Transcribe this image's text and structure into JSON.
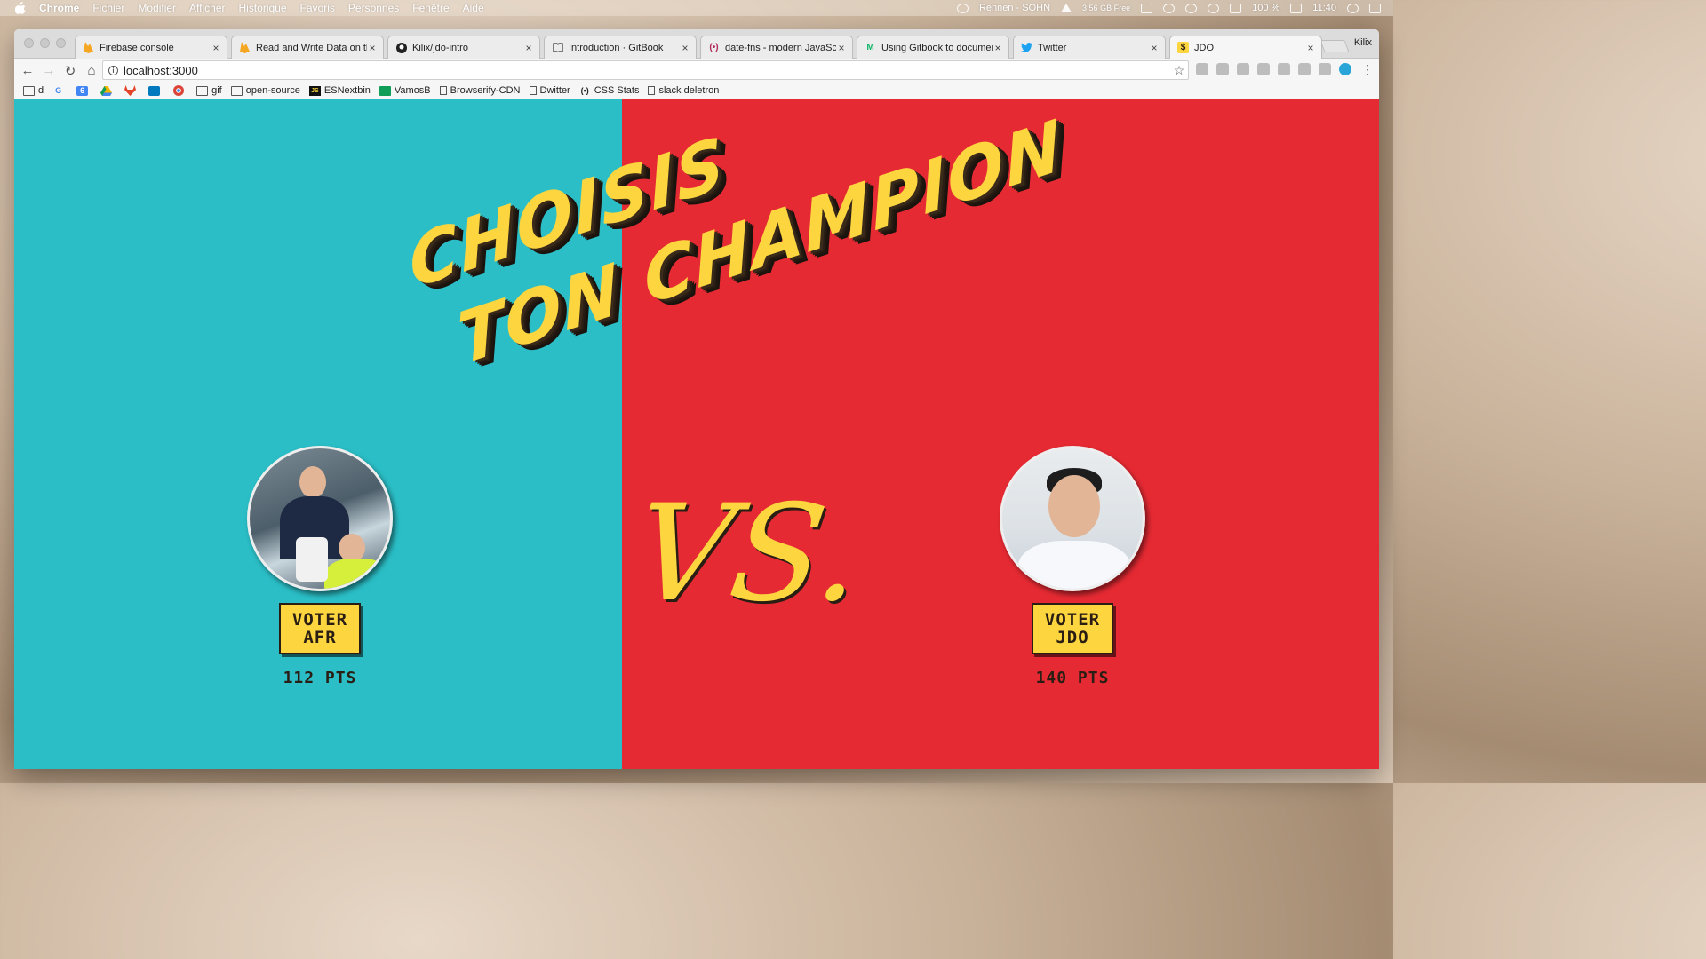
{
  "menubar": {
    "app_name": "Chrome",
    "menus": [
      "Fichier",
      "Modifier",
      "Afficher",
      "Historique",
      "Favoris",
      "Personnes",
      "Fenêtre",
      "Aide"
    ],
    "status_user": "Rennen - SOHN",
    "disk_free": "3,56 GB Free",
    "battery": "100 %",
    "clock": "11:40"
  },
  "browser": {
    "profile_name": "Kilix",
    "tabs": [
      {
        "title": "Firebase console",
        "icon": "firebase-icon",
        "active": false
      },
      {
        "title": "Read and Write Data on the",
        "icon": "firebase-icon",
        "active": false
      },
      {
        "title": "Kilix/jdo-intro",
        "icon": "github-icon",
        "active": false
      },
      {
        "title": "Introduction · GitBook",
        "icon": "gitbook-icon",
        "active": false
      },
      {
        "title": "date-fns - modern JavaScri",
        "icon": "datefns-icon",
        "active": false
      },
      {
        "title": "Using Gitbook to document",
        "icon": "medium-icon",
        "active": false
      },
      {
        "title": "Twitter",
        "icon": "twitter-icon",
        "active": false
      },
      {
        "title": "JDO",
        "icon": "jdo-icon",
        "active": true
      }
    ],
    "url": "localhost:3000",
    "bookmarks": [
      {
        "label": "d",
        "icon": "folder-icon"
      },
      {
        "label": "",
        "icon": "google-icon"
      },
      {
        "label": "",
        "icon": "calendar-icon"
      },
      {
        "label": "",
        "icon": "drive-icon"
      },
      {
        "label": "",
        "icon": "gitlab-icon"
      },
      {
        "label": "",
        "icon": "trello-icon"
      },
      {
        "label": "",
        "icon": "chrome-icon"
      },
      {
        "label": "gif",
        "icon": "folder-icon"
      },
      {
        "label": "open-source",
        "icon": "folder-icon"
      },
      {
        "label": "ESNextbin",
        "icon": "js-icon"
      },
      {
        "label": "VamosB",
        "icon": "sheet-icon"
      },
      {
        "label": "Browserify-CDN",
        "icon": "page-icon"
      },
      {
        "label": "Dwitter",
        "icon": "page-icon"
      },
      {
        "label": "CSS Stats",
        "icon": "cssstats-icon"
      },
      {
        "label": "slack deletron",
        "icon": "slack-icon"
      }
    ]
  },
  "page": {
    "headline_line1": "Choisis",
    "headline_line2": "ton Champion",
    "versus": "VS.",
    "left_color": "#2bbec6",
    "right_color": "#e62a33",
    "accent_color": "#fcd53f",
    "champions": {
      "afr": {
        "vote_line1": "Voter",
        "vote_line2": "AFR",
        "points": "112 PTS"
      },
      "jdo": {
        "vote_line1": "Voter",
        "vote_line2": "JDO",
        "points": "140 PTS"
      }
    }
  }
}
